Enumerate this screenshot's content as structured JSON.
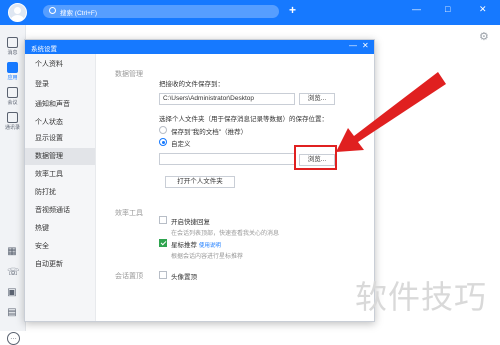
{
  "search": {
    "placeholder": "搜索 (Ctrl+F)"
  },
  "window_controls": {
    "minimize": "—",
    "maximize": "□",
    "close": "✕"
  },
  "leftbar": {
    "items": [
      {
        "label": "消息"
      },
      {
        "label": "应用"
      },
      {
        "label": "会议"
      },
      {
        "label": "通讯录"
      }
    ]
  },
  "dialog": {
    "title": "系统设置",
    "minimize": "—",
    "close": "✕",
    "menu": [
      "个人资料",
      "登录",
      "通知和声音",
      "个人状态",
      "显示设置",
      "数据管理",
      "效率工具",
      "防打扰",
      "音视频通话",
      "热键",
      "安全",
      "自动更新"
    ],
    "selected_index": 5,
    "data_mgmt": {
      "section_title": "数据管理",
      "receive_label": "把接收的文件保存到：",
      "receive_path": "C:\\Users\\Administrator\\Desktop",
      "browse1": "浏览...",
      "personal_folder_label": "选择个人文件夹（用于保存消息记录等数据）的保存位置：",
      "radio1": "保存到\"我的文档\"（推荐）",
      "radio2": "自定义",
      "browse2": "浏览...",
      "open_folder": "打开个人文件夹"
    },
    "efficiency": {
      "section_title": "效率工具",
      "quick_reply": "开启快捷回复",
      "quick_reply_desc": "在会话列表顶部，快速查看我关心的消息",
      "star_recommend": "星标推荐",
      "use_help": "使用说明",
      "star_desc": "根据会话内容进行星标推荐"
    },
    "session": {
      "section_title": "会话置顶",
      "avatar_pin": "头像置顶"
    }
  },
  "watermark": "软件技巧",
  "colors": {
    "brand": "#1679ff",
    "highlight": "#e02020",
    "check": "#2fa44f"
  }
}
